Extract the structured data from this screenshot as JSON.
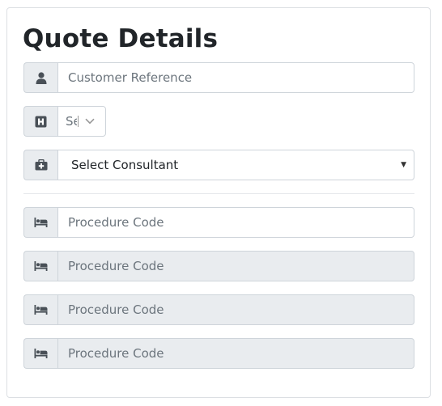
{
  "form": {
    "title": "Quote Details",
    "customer_reference": {
      "placeholder": "Customer Reference"
    },
    "hospital_select": {
      "value": "Se"
    },
    "consultant_select": {
      "value": "Select Consultant"
    },
    "procedure_codes": [
      {
        "placeholder": "Procedure Code",
        "enabled": true
      },
      {
        "placeholder": "Procedure Code",
        "enabled": false
      },
      {
        "placeholder": "Procedure Code",
        "enabled": false
      },
      {
        "placeholder": "Procedure Code",
        "enabled": false
      }
    ]
  },
  "icons": {
    "customer": "user-icon",
    "hospital": "hospital-icon",
    "consultant": "medkit-icon",
    "procedure": "bed-icon"
  },
  "colors": {
    "addon_bg": "#e9ecef",
    "border": "#ced4da",
    "placeholder": "#6c757d"
  }
}
